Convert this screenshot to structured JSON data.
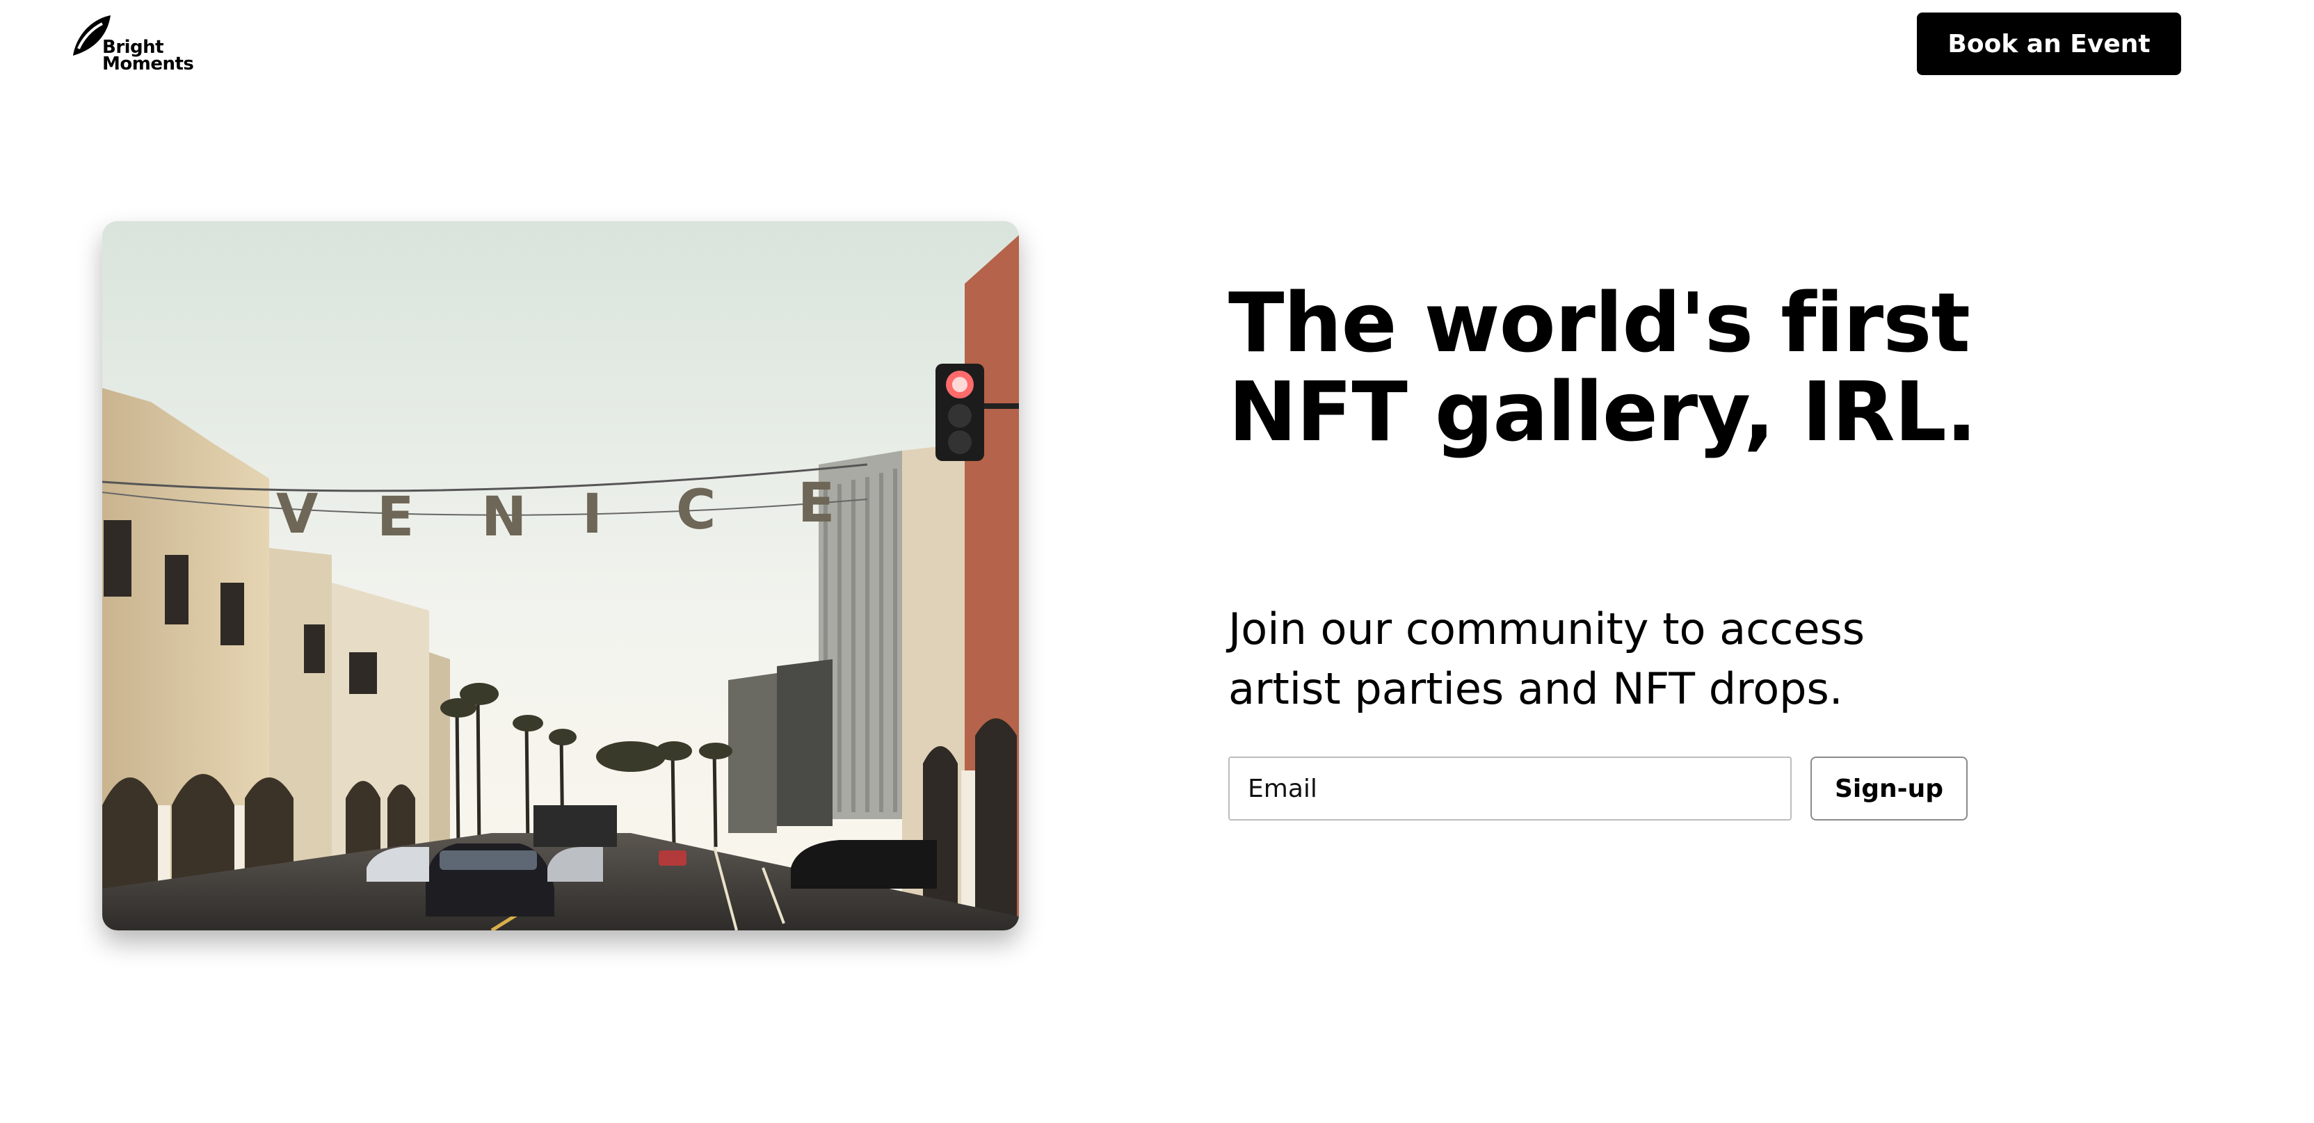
{
  "header": {
    "logo_line1": "Bright",
    "logo_line2": "Moments",
    "book_button": "Book an Event"
  },
  "hero": {
    "image_alt": "Venice Beach street with VENICE sign",
    "image_sign_text": "VENICE",
    "headline_line1": "The world's first",
    "headline_line2": "NFT gallery, IRL.",
    "subtext_line1": "Join our community to access",
    "subtext_line2": "artist parties and NFT drops.",
    "email_placeholder": "Email",
    "email_value": "",
    "signup_button": "Sign-up"
  },
  "colors": {
    "background": "#ffffff",
    "text": "#000000",
    "button_bg": "#000000",
    "button_text": "#ffffff",
    "input_border": "#bdbdbd"
  },
  "icons": {
    "logo": "bright-moments-logo-icon"
  }
}
